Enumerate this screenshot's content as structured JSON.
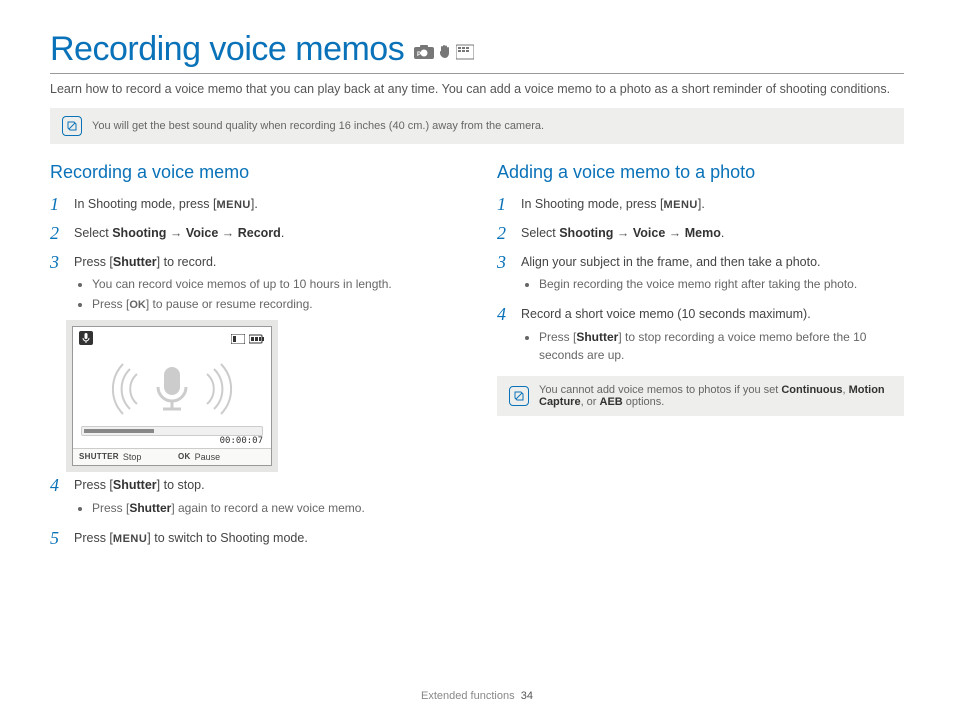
{
  "title": "Recording voice memos",
  "intro": "Learn how to record a voice memo that you can play back at any time. You can add a voice memo to a photo as a short reminder of shooting conditions.",
  "top_note": "You will get the best sound quality when recording 16 inches (40 cm.) away from the camera.",
  "labels": {
    "menu": "MENU",
    "ok": "OK",
    "shutter": "Shutter",
    "shutter_caps": "SHUTTER"
  },
  "left": {
    "heading": "Recording a voice memo",
    "steps": {
      "s1_a": "In Shooting mode, press [",
      "s1_b": "].",
      "s2_a": "Select ",
      "s2_b": "Shooting",
      "s2_c": "Voice",
      "s2_d": "Record",
      "s2_e": ".",
      "s3_a": "Press [",
      "s3_b": "] to record.",
      "s3_sub1": "You can record voice memos of up to 10 hours in length.",
      "s3_sub2_a": "Press [",
      "s3_sub2_b": "] to pause or resume recording.",
      "s4_a": "Press [",
      "s4_b": "] to stop.",
      "s4_sub1_a": "Press [",
      "s4_sub1_b": "] again to record a new voice memo.",
      "s5_a": "Press [",
      "s5_b": "] to switch to Shooting mode."
    }
  },
  "lcd": {
    "time": "00:00:07",
    "stop": "Stop",
    "pause": "Pause"
  },
  "right": {
    "heading": "Adding a voice memo to a photo",
    "steps": {
      "s1_a": "In Shooting mode, press [",
      "s1_b": "].",
      "s2_a": "Select ",
      "s2_b": "Shooting",
      "s2_c": "Voice",
      "s2_d": "Memo",
      "s2_e": ".",
      "s3": "Align your subject in the frame, and then take a photo.",
      "s3_sub1": "Begin recording the voice memo right after taking the photo.",
      "s4": "Record a short voice memo (10 seconds maximum).",
      "s4_sub1_a": "Press [",
      "s4_sub1_b": "] to stop recording a voice memo before the 10 seconds are up."
    },
    "note_a": "You cannot add voice memos to photos if you set ",
    "note_b": "Continuous",
    "note_c": ", ",
    "note_d": "Motion Capture",
    "note_e": ", or ",
    "note_f": "AEB",
    "note_g": " options."
  },
  "footer": {
    "section": "Extended functions",
    "page": "34"
  }
}
